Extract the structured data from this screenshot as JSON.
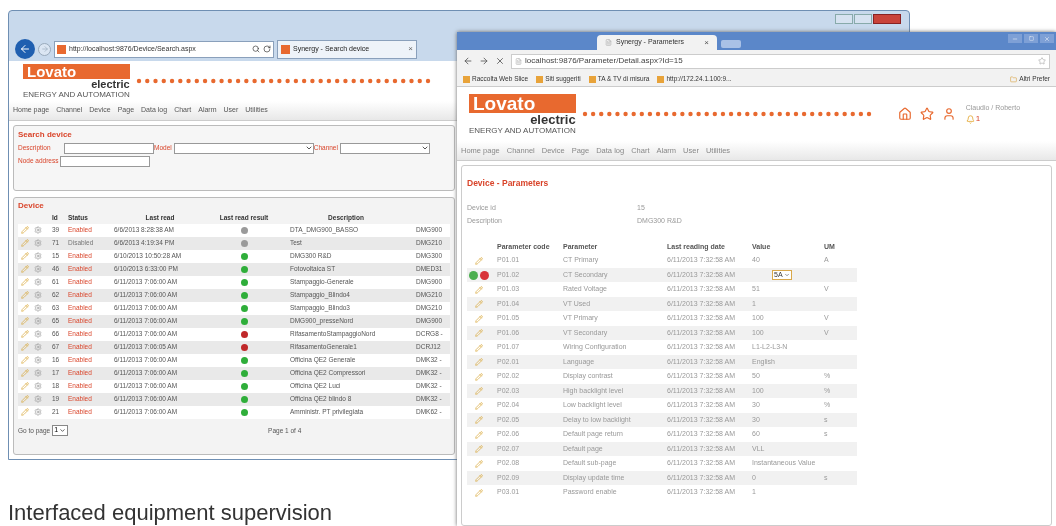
{
  "search_window": {
    "address": "http://localhost:9876/Device/Search.aspx",
    "tab_title": "Synergy - Search device",
    "tab_close": "×",
    "logo": {
      "brand": "Lovato",
      "sub": "electric",
      "tagline": "ENERGY AND AUTOMATION"
    },
    "nav": [
      "Home page",
      "Channel",
      "Device",
      "Page",
      "Data log",
      "Chart",
      "Alarm",
      "User",
      "Utilities"
    ],
    "search_panel": {
      "title": "Search device",
      "fields": [
        {
          "label": "Description",
          "kind": "text"
        },
        {
          "label": "Model",
          "kind": "select"
        },
        {
          "label": "Channel",
          "kind": "select"
        },
        {
          "label": "Node address",
          "kind": "text"
        }
      ]
    },
    "device_panel": {
      "title": "Device",
      "columns": [
        "Id",
        "Status",
        "Last read",
        "Last read result",
        "Description"
      ],
      "rows": [
        {
          "id": "39",
          "status": "Enabled",
          "enabled": true,
          "last_read": "6/6/2013 8:28:38 AM",
          "color": "#9a9a9a",
          "description": "DTA_DMG900_BASSO",
          "column_6": "DMG900"
        },
        {
          "id": "71",
          "status": "Disabled",
          "enabled": false,
          "last_read": "6/6/2013 4:19:34 PM",
          "color": "#9a9a9a",
          "description": "Test",
          "column_6": "DMG210"
        },
        {
          "id": "15",
          "status": "Enabled",
          "enabled": true,
          "last_read": "6/10/2013 10:50:28 AM",
          "color": "#2fae3a",
          "description": "DMG300 R&D",
          "column_6": "DMG300"
        },
        {
          "id": "46",
          "status": "Enabled",
          "enabled": true,
          "last_read": "6/10/2013 6:33:00 PM",
          "color": "#2fae3a",
          "description": "Fotovoltaica ST",
          "column_6": "DMED31"
        },
        {
          "id": "61",
          "status": "Enabled",
          "enabled": true,
          "last_read": "6/11/2013 7:06:00 AM",
          "color": "#2fae3a",
          "description": "Stampaggio-Generale",
          "column_6": "DMG900"
        },
        {
          "id": "62",
          "status": "Enabled",
          "enabled": true,
          "last_read": "6/11/2013 7:06:00 AM",
          "color": "#2fae3a",
          "description": "Stampaggio_Blindo4",
          "column_6": "DMG210"
        },
        {
          "id": "63",
          "status": "Enabled",
          "enabled": true,
          "last_read": "6/11/2013 7:06:00 AM",
          "color": "#2fae3a",
          "description": "Stampaggio_Blindo3",
          "column_6": "DMG210"
        },
        {
          "id": "65",
          "status": "Enabled",
          "enabled": true,
          "last_read": "6/11/2013 7:06:00 AM",
          "color": "#2fae3a",
          "description": "DMG900_presseNord",
          "column_6": "DMG900"
        },
        {
          "id": "66",
          "status": "Enabled",
          "enabled": true,
          "last_read": "6/11/2013 7:06:00 AM",
          "color": "#c0282a",
          "description": "RifasamentoStampaggioNord",
          "column_6": "DCRG8 -"
        },
        {
          "id": "67",
          "status": "Enabled",
          "enabled": true,
          "last_read": "6/11/2013 7:06:05 AM",
          "color": "#c0282a",
          "description": "RifasamentoGenerale1",
          "column_6": "DCRJ12"
        },
        {
          "id": "16",
          "status": "Enabled",
          "enabled": true,
          "last_read": "6/11/2013 7:06:00 AM",
          "color": "#2fae3a",
          "description": "Officina QE2 Generale",
          "column_6": "DMK32 -"
        },
        {
          "id": "17",
          "status": "Enabled",
          "enabled": true,
          "last_read": "6/11/2013 7:06:00 AM",
          "color": "#2fae3a",
          "description": "Officina QE2 Compressori",
          "column_6": "DMK32 -"
        },
        {
          "id": "18",
          "status": "Enabled",
          "enabled": true,
          "last_read": "6/11/2013 7:06:00 AM",
          "color": "#2fae3a",
          "description": "Officina QE2 Luci",
          "column_6": "DMK32 -"
        },
        {
          "id": "19",
          "status": "Enabled",
          "enabled": true,
          "last_read": "6/11/2013 7:06:00 AM",
          "color": "#2fae3a",
          "description": "Officina QE2 blindo 8",
          "column_6": "DMK32 -"
        },
        {
          "id": "21",
          "status": "Enabled",
          "enabled": true,
          "last_read": "6/11/2013 7:06:00 AM",
          "color": "#2fae3a",
          "description": "Amministr. PT privilegiata",
          "column_6": "DMK62 -"
        }
      ],
      "go_to_page_label": "Go to page",
      "page_select": "1",
      "page_info": "Page 1 of 4"
    }
  },
  "parameters_window": {
    "tab_title": "Synergy - Parameters",
    "tab_close": "×",
    "address": "localhost:9876/Parameter/Detail.aspx?Id=15",
    "bookmarks": [
      "Raccolta Web Slice",
      "Siti suggeriti",
      "TA & TV di misura",
      "http://172.24.1.100:9..."
    ],
    "other_bookmarks": "Altri Prefer",
    "logo": {
      "brand": "Lovato",
      "sub": "electric",
      "tagline": "ENERGY AND AUTOMATION"
    },
    "user": "Claudio / Roberto",
    "alarm_count": "1",
    "nav": [
      "Home page",
      "Channel",
      "Device",
      "Page",
      "Data log",
      "Chart",
      "Alarm",
      "User",
      "Utilities"
    ],
    "panel": {
      "title": "Device - Parameters",
      "info": [
        {
          "label": "Device id",
          "value": "15"
        },
        {
          "label": "Description",
          "value": "DMG300 R&D"
        }
      ],
      "columns": [
        "Parameter code",
        "Parameter",
        "Last reading date",
        "Value",
        "UM"
      ],
      "rows": [
        {
          "kind": "view",
          "code": "P01.01",
          "parameter": "CT Primary",
          "date": "6/11/2013 7:32:58 AM",
          "value": "40",
          "um": "A"
        },
        {
          "kind": "edit",
          "code": "P01.02",
          "parameter": "CT Secondary",
          "date": "6/11/2013 7:32:58 AM",
          "value": "5A",
          "um": ""
        },
        {
          "kind": "view",
          "code": "P01.03",
          "parameter": "Rated Voltage",
          "date": "6/11/2013 7:32:58 AM",
          "value": "51",
          "um": "V"
        },
        {
          "kind": "view",
          "code": "P01.04",
          "parameter": "VT Used",
          "date": "6/11/2013 7:32:58 AM",
          "value": "1",
          "um": ""
        },
        {
          "kind": "view",
          "code": "P01.05",
          "parameter": "VT Primary",
          "date": "6/11/2013 7:32:58 AM",
          "value": "100",
          "um": "V"
        },
        {
          "kind": "view",
          "code": "P01.06",
          "parameter": "VT Secondary",
          "date": "6/11/2013 7:32:58 AM",
          "value": "100",
          "um": "V"
        },
        {
          "kind": "view",
          "code": "P01.07",
          "parameter": "Wiring Configuration",
          "date": "6/11/2013 7:32:58 AM",
          "value": "L1-L2-L3-N",
          "um": ""
        },
        {
          "kind": "view",
          "code": "P02.01",
          "parameter": "Language",
          "date": "6/11/2013 7:32:58 AM",
          "value": "English",
          "um": ""
        },
        {
          "kind": "view",
          "code": "P02.02",
          "parameter": "Display contrast",
          "date": "6/11/2013 7:32:58 AM",
          "value": "50",
          "um": "%"
        },
        {
          "kind": "view",
          "code": "P02.03",
          "parameter": "High backlight level",
          "date": "6/11/2013 7:32:58 AM",
          "value": "100",
          "um": "%"
        },
        {
          "kind": "view",
          "code": "P02.04",
          "parameter": "Low backlight level",
          "date": "6/11/2013 7:32:58 AM",
          "value": "30",
          "um": "%"
        },
        {
          "kind": "view",
          "code": "P02.05",
          "parameter": "Delay to low backlight",
          "date": "6/11/2013 7:32:58 AM",
          "value": "30",
          "um": "s"
        },
        {
          "kind": "view",
          "code": "P02.06",
          "parameter": "Default page return",
          "date": "6/11/2013 7:32:58 AM",
          "value": "60",
          "um": "s"
        },
        {
          "kind": "view",
          "code": "P02.07",
          "parameter": "Default page",
          "date": "6/11/2013 7:32:58 AM",
          "value": "VLL",
          "um": ""
        },
        {
          "kind": "view",
          "code": "P02.08",
          "parameter": "Default sub-page",
          "date": "6/11/2013 7:32:58 AM",
          "value": "Instantaneous Value",
          "um": ""
        },
        {
          "kind": "view",
          "code": "P02.09",
          "parameter": "Display update time",
          "date": "6/11/2013 7:32:58 AM",
          "value": "0",
          "um": "s"
        },
        {
          "kind": "view",
          "code": "P03.01",
          "parameter": "Password enable",
          "date": "6/11/2013 7:32:58 AM",
          "value": "1",
          "um": ""
        }
      ]
    }
  },
  "caption": "Interfaced equipment supervision"
}
